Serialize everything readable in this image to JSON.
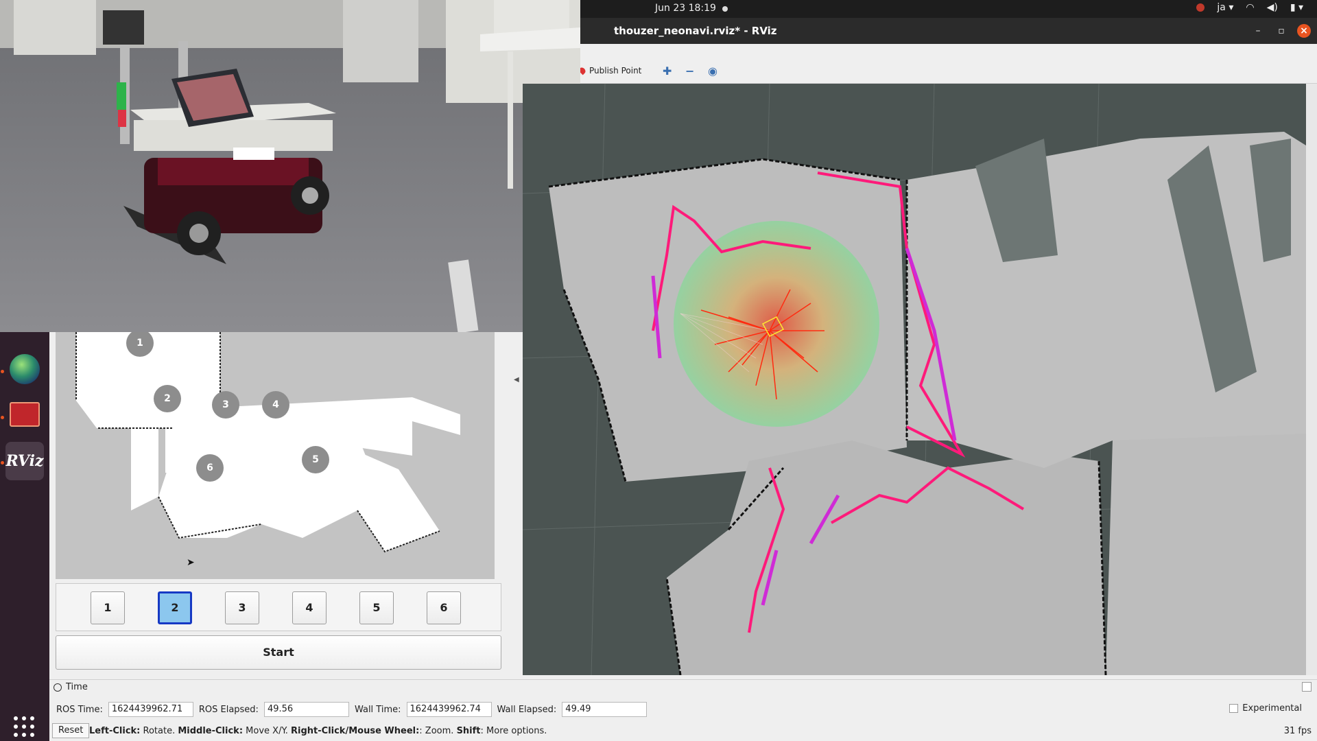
{
  "topbar": {
    "clock": "Jun 23  18:19",
    "lang": "ja ▾"
  },
  "window": {
    "title": "thouzer_neonavi.rviz* - RViz"
  },
  "toolbar": {
    "publish_point": "Publish Point"
  },
  "waypoint_map": {
    "markers": [
      "1",
      "2",
      "3",
      "4",
      "5",
      "6"
    ]
  },
  "waypoint_buttons": [
    {
      "label": "1",
      "active": false
    },
    {
      "label": "2",
      "active": true
    },
    {
      "label": "3",
      "active": false
    },
    {
      "label": "4",
      "active": false
    },
    {
      "label": "5",
      "active": false
    },
    {
      "label": "6",
      "active": false
    }
  ],
  "start_button": "Start",
  "time_panel": {
    "header": "Time",
    "ros_time_label": "ROS Time:",
    "ros_time": "1624439962.71",
    "ros_elapsed_label": "ROS Elapsed:",
    "ros_elapsed": "49.56",
    "wall_time_label": "Wall Time:",
    "wall_time": "1624439962.74",
    "wall_elapsed_label": "Wall Elapsed:",
    "wall_elapsed": "49.49",
    "experimental_label": "Experimental"
  },
  "status_bar": {
    "reset": "Reset",
    "hint_left_click": "Left-Click:",
    "hint_left_action": " Rotate. ",
    "hint_middle_click": "Middle-Click:",
    "hint_middle_action": " Move X/Y. ",
    "hint_right_click": "Right-Click/Mouse Wheel:",
    "hint_right_action": ": Zoom. ",
    "hint_shift": "Shift",
    "hint_shift_action": ": More options.",
    "fps": "31 fps"
  },
  "colors": {
    "accent": "#e95420",
    "path": "#e0108a",
    "laser": "#ff2020",
    "active_button": "#8cc7ee"
  }
}
